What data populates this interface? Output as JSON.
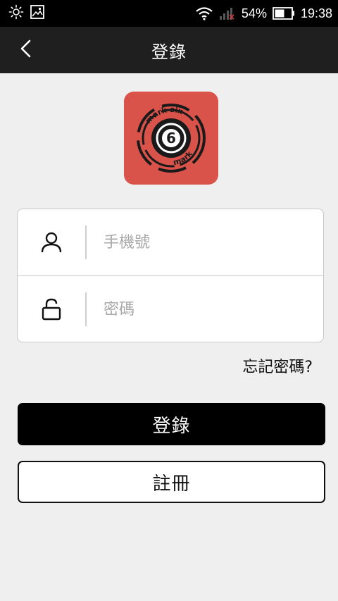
{
  "status": {
    "battery_percent": "54%",
    "time": "19:38",
    "icons": [
      "brightness-icon",
      "image-icon",
      "wifi-icon",
      "signal-icon",
      "battery-icon"
    ]
  },
  "nav": {
    "title": "登錄",
    "back_icon": "chevron-left-icon"
  },
  "logo": {
    "text_top": "mark six",
    "text_bottom": "mark six",
    "number": "6",
    "background": "#d9534a"
  },
  "form": {
    "phone_placeholder": "手機號",
    "password_placeholder": "密碼",
    "phone_icon": "user-icon",
    "password_icon": "lock-icon"
  },
  "forgot_password": "忘記密碼?",
  "buttons": {
    "login": "登錄",
    "register": "註冊"
  }
}
